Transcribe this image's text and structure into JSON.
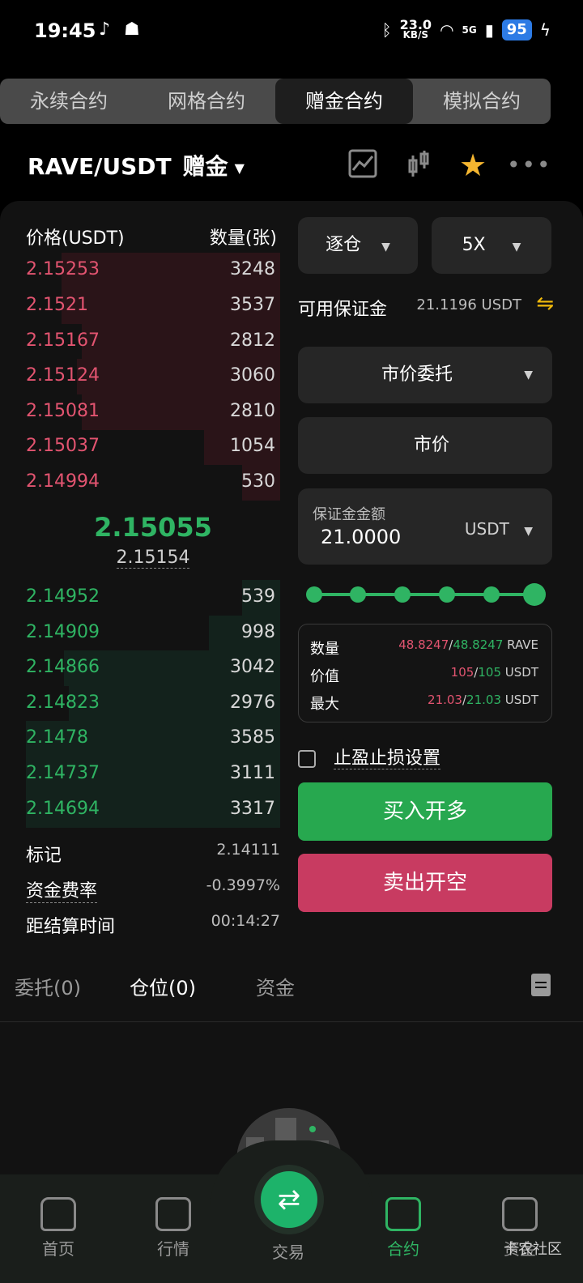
{
  "status_bar": {
    "time": "19:45",
    "net_speed_value": "23.0",
    "net_speed_unit": "KB/S",
    "network": "5G",
    "battery": "95"
  },
  "top_tabs": [
    "永续合约",
    "网格合约",
    "赠金合约",
    "模拟合约"
  ],
  "header": {
    "pair": "RAVE/USDT",
    "badge": "赠金"
  },
  "orderbook": {
    "price_header": "价格(USDT)",
    "qty_header": "数量(张)",
    "asks": [
      {
        "price": "2.15253",
        "qty": "3248"
      },
      {
        "price": "2.1521",
        "qty": "3537"
      },
      {
        "price": "2.15167",
        "qty": "2812"
      },
      {
        "price": "2.15124",
        "qty": "3060"
      },
      {
        "price": "2.15081",
        "qty": "2810"
      },
      {
        "price": "2.15037",
        "qty": "1054"
      },
      {
        "price": "2.14994",
        "qty": "530"
      }
    ],
    "last_price": "2.15055",
    "mark_price": "2.15154",
    "bids": [
      {
        "price": "2.14952",
        "qty": "539"
      },
      {
        "price": "2.14909",
        "qty": "998"
      },
      {
        "price": "2.14866",
        "qty": "3042"
      },
      {
        "price": "2.14823",
        "qty": "2976"
      },
      {
        "price": "2.1478",
        "qty": "3585"
      },
      {
        "price": "2.14737",
        "qty": "3111"
      },
      {
        "price": "2.14694",
        "qty": "3317"
      }
    ]
  },
  "market_info": {
    "mark_label": "标记",
    "mark_value": "2.14111",
    "funding_label": "资金费率",
    "funding_value": "-0.3997%",
    "settle_label": "距结算时间",
    "settle_value": "00:14:27"
  },
  "form": {
    "margin_mode": "逐仓",
    "leverage": "5X",
    "available_label": "可用保证金",
    "available_value": "21.1196 USDT",
    "order_type": "市价委托",
    "price_input": "市价",
    "amount_label": "保证金金额",
    "amount_value": "21.0000",
    "amount_unit": "USDT",
    "summary": {
      "qty_label": "数量",
      "qty_a": "48.8247",
      "qty_b": "48.8247",
      "qty_unit": "RAVE",
      "value_label": "价值",
      "value_a": "105",
      "value_b": "105",
      "value_unit": "USDT",
      "max_label": "最大",
      "max_a": "21.03",
      "max_b": "21.03",
      "max_unit": "USDT"
    },
    "tpsl_label": "止盈止损设置",
    "buy_label": "买入开多",
    "sell_label": "卖出开空"
  },
  "bottom_tabs": [
    "委托(0)",
    "仓位(0)",
    "资金"
  ],
  "nav": [
    "首页",
    "行情",
    "交易",
    "合约",
    "资金"
  ],
  "watermark": "卡农社区",
  "colors": {
    "ask": "#e25470",
    "bid": "#2fb463",
    "buy_button": "#27a84f",
    "sell_button": "#c83b61"
  }
}
